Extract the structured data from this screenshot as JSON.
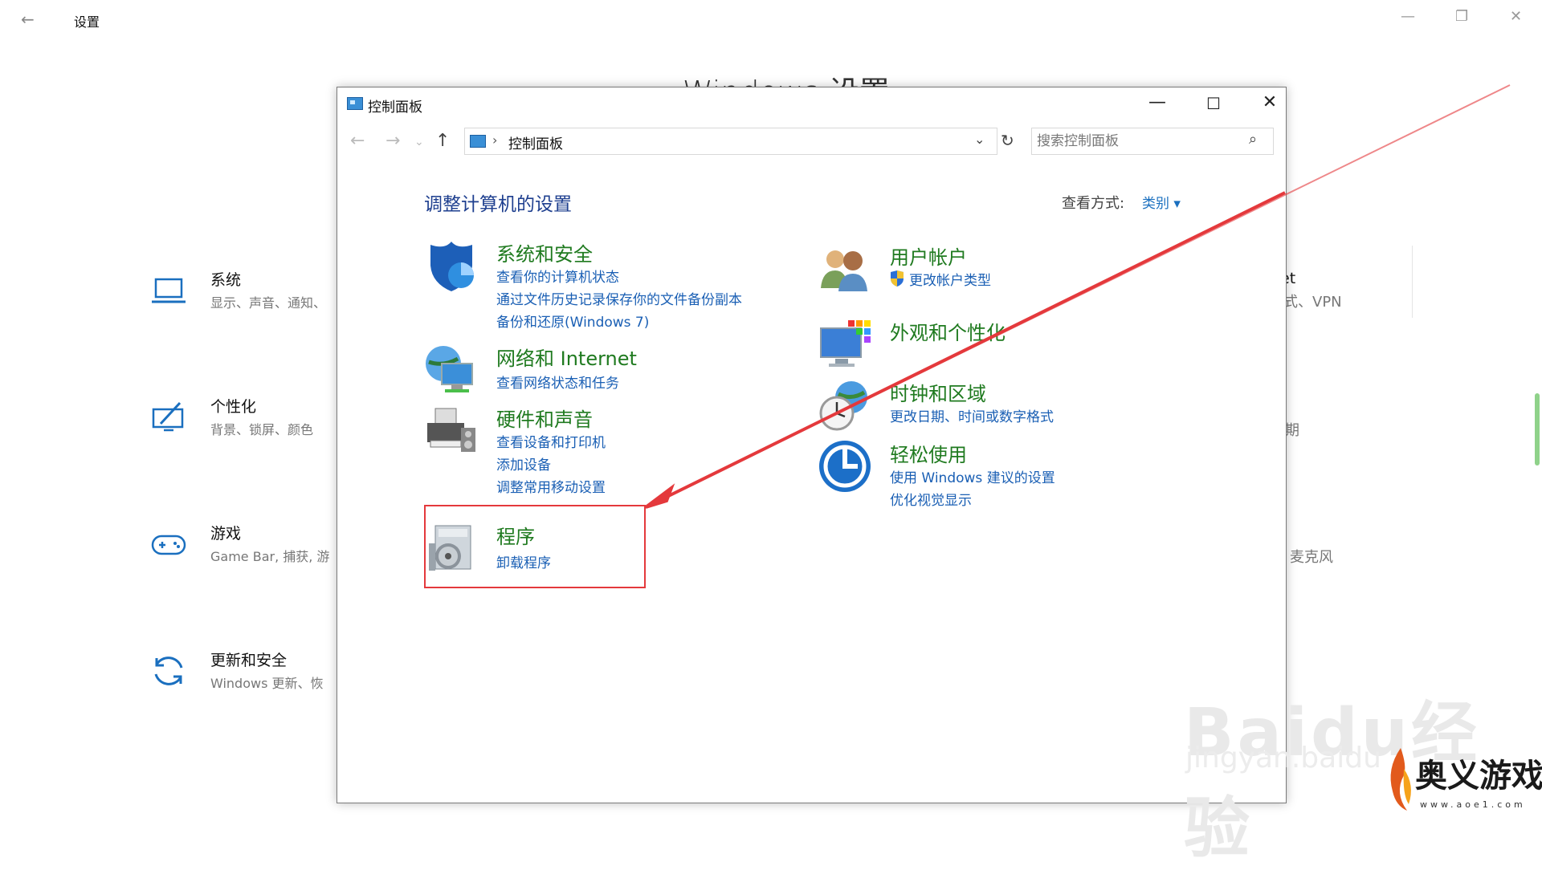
{
  "settings": {
    "title": "设置",
    "heading": "Windows 设置",
    "items": [
      {
        "name": "系统",
        "desc": "显示、声音、通知、"
      },
      {
        "name": "个性化",
        "desc": "背景、锁屏、颜色"
      },
      {
        "name": "游戏",
        "desc": "Game Bar, 捕获, 游"
      },
      {
        "name": "更新和安全",
        "desc": "Windows 更新、恢"
      }
    ],
    "right_texts": [
      "et",
      "式、VPN",
      "期",
      "麦克风"
    ]
  },
  "control_panel": {
    "title": "控制面板",
    "address": "控制面板",
    "search_placeholder": "搜索控制面板",
    "heading": "调整计算机的设置",
    "view_label": "查看方式:",
    "view_value": "类别 ▾",
    "categories": {
      "security": {
        "title": "系统和安全",
        "links": [
          "查看你的计算机状态",
          "通过文件历史记录保存你的文件备份副本",
          "备份和还原(Windows 7)"
        ]
      },
      "network": {
        "title": "网络和 Internet",
        "links": [
          "查看网络状态和任务"
        ]
      },
      "hardware": {
        "title": "硬件和声音",
        "links": [
          "查看设备和打印机",
          "添加设备",
          "调整常用移动设置"
        ]
      },
      "programs": {
        "title": "程序",
        "links": [
          "卸载程序"
        ]
      },
      "users": {
        "title": "用户帐户",
        "links": [
          "更改帐户类型"
        ]
      },
      "appearance": {
        "title": "外观和个性化",
        "links": []
      },
      "clock": {
        "title": "时钟和区域",
        "links": [
          "更改日期、时间或数字格式"
        ]
      },
      "ease": {
        "title": "轻松使用",
        "links": [
          "使用 Windows 建议的设置",
          "优化视觉显示"
        ]
      }
    }
  },
  "watermark": {
    "baidu": "Baidu经验",
    "url": "jingyan.baidu",
    "brand": "奥义游戏网",
    "brand_url": "www.aoe1.com"
  },
  "colors": {
    "highlight": "#e4393c",
    "link": "#1a5fb4",
    "category_title": "#1f7a1f",
    "heading": "#1e3f8f"
  }
}
